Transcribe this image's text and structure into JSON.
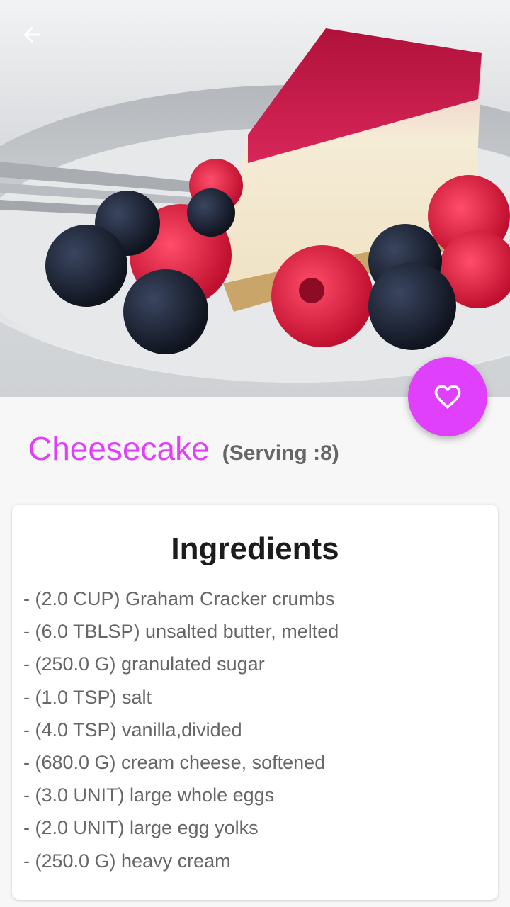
{
  "nav": {
    "back_icon": "arrow-left-icon"
  },
  "favorite": {
    "icon": "heart-outline-icon",
    "color": "#e040fb"
  },
  "recipe": {
    "title": "Cheesecake",
    "serving": "(Serving :8)"
  },
  "ingredients": {
    "heading": "Ingredients",
    "items": [
      "- (2.0 CUP) Graham Cracker crumbs",
      "- (6.0 TBLSP) unsalted butter, melted",
      "- (250.0 G) granulated sugar",
      "- (1.0 TSP) salt",
      "- (4.0 TSP) vanilla,divided",
      "- (680.0 G) cream cheese, softened",
      "- (3.0 UNIT) large whole eggs",
      "- (2.0 UNIT) large egg yolks",
      "- (250.0 G) heavy cream"
    ]
  },
  "colors": {
    "accent": "#e040fb",
    "text_secondary": "#666666",
    "heading": "#1c1c1c"
  }
}
